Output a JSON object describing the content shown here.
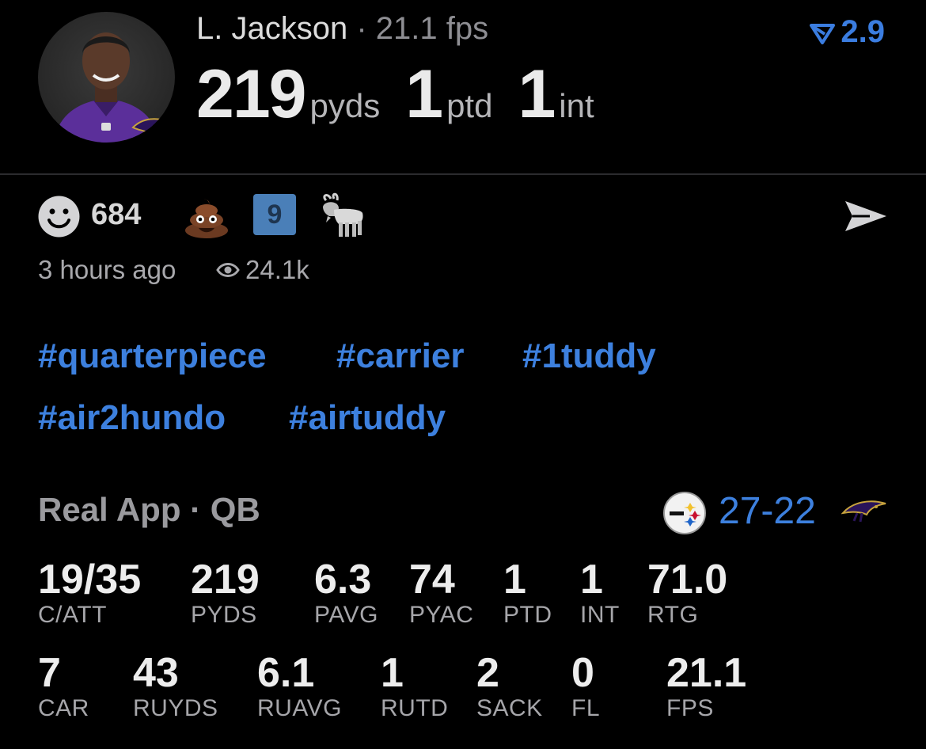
{
  "player": {
    "name": "L. Jackson",
    "separator": " · ",
    "fps_text": "21.1 fps",
    "delta_value": "2.9",
    "headline": [
      {
        "value": "219",
        "unit": "pyds"
      },
      {
        "value": "1",
        "unit": "ptd"
      },
      {
        "value": "1",
        "unit": "int"
      }
    ]
  },
  "reactions": {
    "smile_count": "684",
    "nine_badge": "9",
    "time_ago": "3 hours ago",
    "views": "24.1k"
  },
  "hashtags": [
    "#quarterpiece",
    "#carrier",
    "#1tuddy",
    "#air2hundo",
    "#airtuddy"
  ],
  "game": {
    "league_label": "Real App · QB",
    "score": "27-22"
  },
  "stats_row1": [
    {
      "value": "19/35",
      "label": "C/ATT"
    },
    {
      "value": "219",
      "label": "PYDS"
    },
    {
      "value": "6.3",
      "label": "PAVG"
    },
    {
      "value": "74",
      "label": "PYAC"
    },
    {
      "value": "1",
      "label": "PTD"
    },
    {
      "value": "1",
      "label": "INT"
    },
    {
      "value": "71.0",
      "label": "RTG"
    }
  ],
  "stats_row2": [
    {
      "value": "7",
      "label": "CAR"
    },
    {
      "value": "43",
      "label": "RUYDS"
    },
    {
      "value": "6.1",
      "label": "RUAVG"
    },
    {
      "value": "1",
      "label": "RUTD"
    },
    {
      "value": "2",
      "label": "SACK"
    },
    {
      "value": "0",
      "label": "FL"
    },
    {
      "value": "21.1",
      "label": "FPS"
    }
  ],
  "colors": {
    "accent": "#3d80de",
    "background": "#000000",
    "ravens_purple": "#5b2f9a"
  },
  "icons": [
    "player-avatar",
    "smile-icon",
    "poop-emoji-icon",
    "nine-badge-icon",
    "goat-emoji-icon",
    "send-icon",
    "eye-icon",
    "steelers-logo-icon",
    "ravens-logo-icon",
    "trend-arrow-icon"
  ]
}
